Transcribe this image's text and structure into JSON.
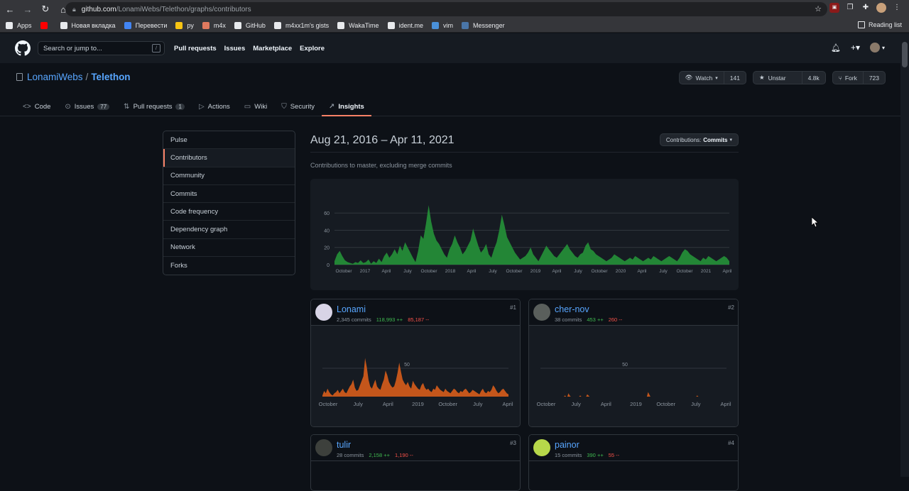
{
  "browser": {
    "url_host": "github.com",
    "url_path": "/LonamiWebs/Telethon/graphs/contributors",
    "bookmarks": [
      {
        "label": "Apps",
        "color": "#e8eaed"
      },
      {
        "label": "",
        "color": "#ff0000"
      },
      {
        "label": "Новая вкладка",
        "color": "#e8eaed"
      },
      {
        "label": "Перевести",
        "color": "#4285f4"
      },
      {
        "label": "py",
        "color": "#f9c513"
      },
      {
        "label": "m4x",
        "color": "#e07a5f"
      },
      {
        "label": "GitHub",
        "color": "#e8eaed"
      },
      {
        "label": "m4xx1m's gists",
        "color": "#e8eaed"
      },
      {
        "label": "WakaTime",
        "color": "#e8eaed"
      },
      {
        "label": "ident.me",
        "color": "#e8eaed"
      },
      {
        "label": "vim",
        "color": "#4a90d9"
      },
      {
        "label": "Messenger",
        "color": "#4a76a8"
      }
    ],
    "reading_list": "Reading list"
  },
  "header": {
    "search_placeholder": "Search or jump to...",
    "search_key": "/",
    "nav": [
      "Pull requests",
      "Issues",
      "Marketplace",
      "Explore"
    ]
  },
  "repo": {
    "owner": "LonamiWebs",
    "separator": "/",
    "name": "Telethon",
    "watch_label": "Watch",
    "watch_count": "141",
    "star_label": "Unstar",
    "star_count": "4.8k",
    "fork_label": "Fork",
    "fork_count": "723"
  },
  "tabs": [
    {
      "label": "Code",
      "icon": "<>",
      "badge": ""
    },
    {
      "label": "Issues",
      "icon": "⊙",
      "badge": "77"
    },
    {
      "label": "Pull requests",
      "icon": "⇅",
      "badge": "1"
    },
    {
      "label": "Actions",
      "icon": "▷",
      "badge": ""
    },
    {
      "label": "Wiki",
      "icon": "▭",
      "badge": ""
    },
    {
      "label": "Security",
      "icon": "⛉",
      "badge": ""
    },
    {
      "label": "Insights",
      "icon": "↗",
      "badge": ""
    }
  ],
  "sidebar": {
    "items": [
      "Pulse",
      "Contributors",
      "Community",
      "Commits",
      "Code frequency",
      "Dependency graph",
      "Network",
      "Forks"
    ]
  },
  "main": {
    "date_range": "Aug 21, 2016 – Apr 11, 2021",
    "select_label": "Contributions:",
    "select_value": "Commits",
    "subtitle": "Contributions to master, excluding merge commits"
  },
  "chart_data": [
    {
      "type": "area",
      "title": "",
      "color": "#238636",
      "ylim": [
        0,
        75
      ],
      "yticks": [
        0,
        20,
        40,
        60
      ],
      "xticks": [
        "October",
        "2017",
        "April",
        "July",
        "October",
        "2018",
        "April",
        "July",
        "October",
        "2019",
        "April",
        "July",
        "October",
        "2020",
        "April",
        "July",
        "October",
        "2021",
        "April"
      ],
      "values": [
        4,
        12,
        16,
        10,
        5,
        3,
        2,
        1,
        3,
        2,
        5,
        2,
        3,
        6,
        1,
        4,
        2,
        7,
        3,
        10,
        14,
        8,
        12,
        18,
        12,
        22,
        16,
        26,
        20,
        14,
        8,
        3,
        16,
        34,
        30,
        48,
        69,
        50,
        36,
        28,
        24,
        18,
        12,
        8,
        18,
        24,
        34,
        26,
        20,
        12,
        16,
        22,
        28,
        42,
        32,
        22,
        14,
        18,
        24,
        12,
        8,
        18,
        26,
        40,
        58,
        46,
        32,
        26,
        20,
        14,
        10,
        6,
        8,
        10,
        14,
        20,
        12,
        8,
        4,
        10,
        16,
        22,
        18,
        14,
        10,
        8,
        12,
        16,
        20,
        24,
        18,
        14,
        10,
        8,
        12,
        14,
        22,
        26,
        18,
        16,
        12,
        10,
        8,
        6,
        4,
        6,
        8,
        12,
        10,
        8,
        6,
        4,
        6,
        8,
        6,
        10,
        8,
        6,
        4,
        6,
        8,
        6,
        10,
        8,
        6,
        4,
        6,
        8,
        10,
        8,
        6,
        4,
        8,
        14,
        18,
        16,
        12,
        10,
        8,
        6,
        4,
        8,
        6,
        10,
        8,
        6,
        4,
        6,
        8,
        10,
        8,
        4
      ]
    },
    {
      "type": "area",
      "title": "Lonami",
      "color": "#c4561b",
      "ylim": [
        0,
        100
      ],
      "yticks": [
        50
      ],
      "xticks": [
        "October",
        "July",
        "April",
        "2019",
        "October",
        "July",
        "April"
      ],
      "values": [
        2,
        10,
        6,
        14,
        8,
        4,
        2,
        6,
        8,
        12,
        6,
        10,
        14,
        8,
        6,
        12,
        18,
        22,
        30,
        16,
        10,
        12,
        20,
        28,
        36,
        68,
        52,
        30,
        18,
        14,
        22,
        30,
        18,
        14,
        12,
        22,
        30,
        46,
        38,
        26,
        20,
        16,
        18,
        28,
        42,
        60,
        44,
        30,
        24,
        20,
        26,
        18,
        14,
        28,
        22,
        18,
        14,
        12,
        20,
        24,
        16,
        12,
        14,
        10,
        8,
        14,
        12,
        20,
        16,
        12,
        10,
        8,
        14,
        10,
        8,
        6,
        10,
        14,
        12,
        8,
        6,
        10,
        8,
        12,
        14,
        10,
        6,
        8,
        12,
        10,
        8,
        6,
        4,
        10,
        14,
        8,
        6,
        10,
        8,
        12,
        20,
        16,
        10,
        6,
        8,
        12,
        14,
        10,
        6,
        4
      ]
    },
    {
      "type": "area",
      "title": "cher-nov",
      "color": "#c4561b",
      "ylim": [
        0,
        100
      ],
      "yticks": [
        50
      ],
      "xticks": [
        "October",
        "July",
        "April",
        "2019",
        "October",
        "July",
        "April"
      ],
      "values": [
        0,
        0,
        0,
        0,
        0,
        0,
        0,
        0,
        0,
        0,
        0,
        0,
        0,
        0,
        0,
        0,
        0,
        0,
        0,
        0,
        0,
        2,
        0,
        0,
        6,
        2,
        0,
        0,
        0,
        0,
        0,
        0,
        0,
        0,
        2,
        0,
        0,
        0,
        0,
        0,
        4,
        2,
        0,
        0,
        0,
        0,
        0,
        0,
        0,
        0,
        0,
        0,
        0,
        0,
        0,
        0,
        0,
        0,
        0,
        0,
        0,
        0,
        0,
        0,
        0,
        0,
        0,
        0,
        0,
        0,
        0,
        0,
        0,
        0,
        0,
        0,
        0,
        0,
        0,
        0,
        0,
        0,
        0,
        0,
        0,
        0,
        0,
        0,
        0,
        0,
        0,
        0,
        8,
        4,
        0,
        0,
        0,
        0,
        0,
        0,
        0,
        0,
        0,
        0,
        0,
        0,
        0,
        0,
        0,
        0,
        0,
        0,
        0,
        0,
        0,
        0,
        0,
        0,
        0,
        0,
        0,
        0,
        0,
        0,
        0,
        0,
        0,
        0,
        0,
        0,
        0,
        0,
        0,
        0,
        2,
        0,
        0,
        0,
        0,
        0,
        0,
        0,
        0,
        0,
        0,
        0,
        0,
        0,
        0,
        0,
        0,
        0,
        0,
        0,
        0,
        0,
        0,
        0,
        0,
        0
      ]
    }
  ],
  "contributors": [
    {
      "name": "Lonami",
      "commits": "2,345 commits",
      "additions": "118,993 ++",
      "deletions": "85,187 --",
      "rank": "#1",
      "avatar_color": "#d8d4e6"
    },
    {
      "name": "cher-nov",
      "commits": "38 commits",
      "additions": "453 ++",
      "deletions": "260 --",
      "rank": "#2",
      "avatar_color": "#5a5f5c"
    },
    {
      "name": "tulir",
      "commits": "28 commits",
      "additions": "2,158 ++",
      "deletions": "1,190 --",
      "rank": "#3",
      "avatar_color": "#3d403c"
    },
    {
      "name": "painor",
      "commits": "15 commits",
      "additions": "390 ++",
      "deletions": "55 --",
      "rank": "#4",
      "avatar_color": "#b7d84a"
    }
  ]
}
